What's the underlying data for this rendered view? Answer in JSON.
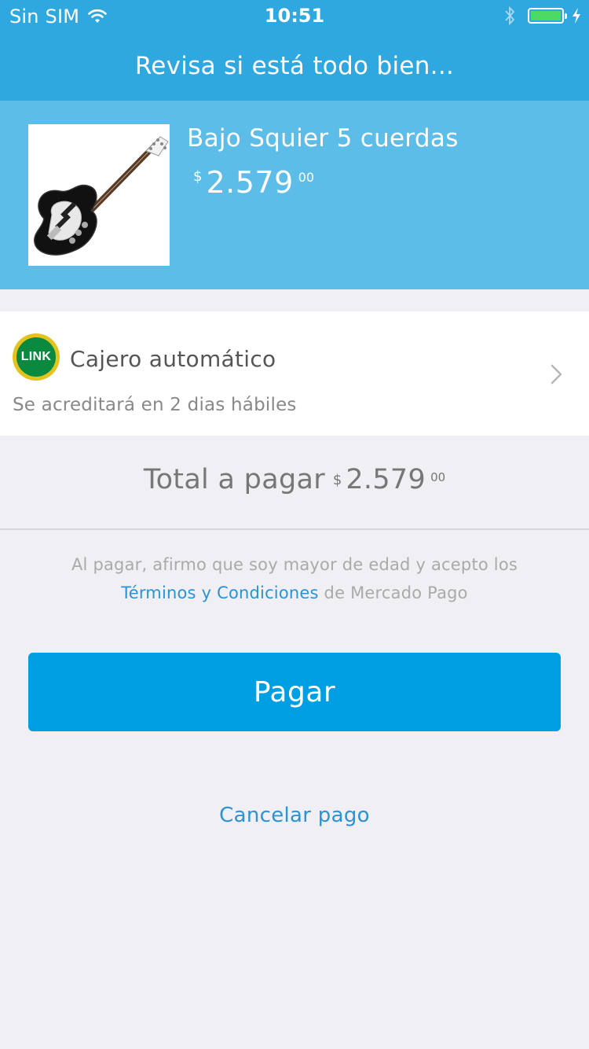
{
  "status_bar": {
    "carrier": "Sin SIM",
    "time": "10:51",
    "battery_color": "#4cd964",
    "icons": [
      "wifi-icon",
      "bluetooth-icon",
      "battery-icon",
      "charging-icon"
    ]
  },
  "nav": {
    "title": "Revisa si está todo bien..."
  },
  "product": {
    "title": "Bajo Squier 5 cuerdas",
    "price_currency": "$",
    "price_integer": "2.579",
    "price_cents": "00",
    "image": "bass-guitar-image"
  },
  "payment": {
    "logo_text": "LINK",
    "method": "Cajero automático",
    "note": "Se acreditará en 2 dias hábiles",
    "chevron": "chevron-right-icon"
  },
  "total": {
    "label": "Total a pagar",
    "currency": "$",
    "integer": "2.579",
    "cents": "00"
  },
  "terms": {
    "prefix": "Al pagar, afirmo que soy mayor de edad y acepto los ",
    "link": "Términos y Condiciones",
    "suffix": " de Mercado Pago"
  },
  "actions": {
    "pay": "Pagar",
    "cancel": "Cancelar pago"
  },
  "colors": {
    "header": "#2fa8e0",
    "product_card": "#5bbde8",
    "button": "#009ee3",
    "link": "#2a93d5",
    "background": "#efeff4"
  }
}
